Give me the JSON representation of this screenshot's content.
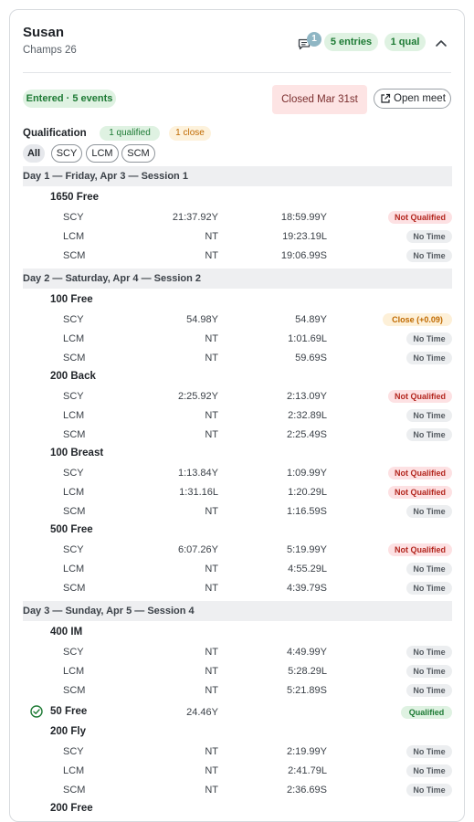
{
  "header": {
    "name": "Susan",
    "meet": "Champs 26",
    "message_count": "1",
    "entries_badge": "5 entries",
    "qual_badge": "1 qual"
  },
  "status": {
    "entered": "Entered · 5 events",
    "closed": "Closed Mar 31st",
    "open_meet": "Open meet"
  },
  "qualification": {
    "label": "Qualification",
    "qualified_badge": "1 qualified",
    "close_badge": "1 close"
  },
  "filters": [
    "All",
    "SCY",
    "LCM",
    "SCM"
  ],
  "colors": {
    "not_qualified": "#b3261e",
    "qualified": "#1d7a34",
    "close": "#c06a00",
    "day_header_bg": "#eeeff1"
  },
  "days": [
    {
      "title": "Day 1 — Friday, Apr 3 — Session 1",
      "events": [
        {
          "name": "1650 Free",
          "rows": [
            {
              "course": "SCY",
              "best": "21:37.92Y",
              "std": "18:59.99Y",
              "status": "Not Qualified",
              "kind": "nq"
            },
            {
              "course": "LCM",
              "best": "NT",
              "std": "19:23.19L",
              "status": "No Time",
              "kind": "nt"
            },
            {
              "course": "SCM",
              "best": "NT",
              "std": "19:06.99S",
              "status": "No Time",
              "kind": "nt"
            }
          ]
        }
      ]
    },
    {
      "title": "Day 2 — Saturday, Apr 4 — Session 2",
      "events": [
        {
          "name": "100 Free",
          "rows": [
            {
              "course": "SCY",
              "best": "54.98Y",
              "std": "54.89Y",
              "status": "Close (+0.09)",
              "kind": "cl"
            },
            {
              "course": "LCM",
              "best": "NT",
              "std": "1:01.69L",
              "status": "No Time",
              "kind": "nt"
            },
            {
              "course": "SCM",
              "best": "NT",
              "std": "59.69S",
              "status": "No Time",
              "kind": "nt"
            }
          ]
        },
        {
          "name": "200 Back",
          "rows": [
            {
              "course": "SCY",
              "best": "2:25.92Y",
              "std": "2:13.09Y",
              "status": "Not Qualified",
              "kind": "nq"
            },
            {
              "course": "LCM",
              "best": "NT",
              "std": "2:32.89L",
              "status": "No Time",
              "kind": "nt"
            },
            {
              "course": "SCM",
              "best": "NT",
              "std": "2:25.49S",
              "status": "No Time",
              "kind": "nt"
            }
          ]
        },
        {
          "name": "100 Breast",
          "rows": [
            {
              "course": "SCY",
              "best": "1:13.84Y",
              "std": "1:09.99Y",
              "status": "Not Qualified",
              "kind": "nq"
            },
            {
              "course": "LCM",
              "best": "1:31.16L",
              "std": "1:20.29L",
              "status": "Not Qualified",
              "kind": "nq"
            },
            {
              "course": "SCM",
              "best": "NT",
              "std": "1:16.59S",
              "status": "No Time",
              "kind": "nt"
            }
          ]
        },
        {
          "name": "500 Free",
          "rows": [
            {
              "course": "SCY",
              "best": "6:07.26Y",
              "std": "5:19.99Y",
              "status": "Not Qualified",
              "kind": "nq"
            },
            {
              "course": "LCM",
              "best": "NT",
              "std": "4:55.29L",
              "status": "No Time",
              "kind": "nt"
            },
            {
              "course": "SCM",
              "best": "NT",
              "std": "4:39.79S",
              "status": "No Time",
              "kind": "nt"
            }
          ]
        }
      ]
    },
    {
      "title": "Day 3 — Sunday, Apr 5 — Session 4",
      "events": [
        {
          "name": "400 IM",
          "rows": [
            {
              "course": "SCY",
              "best": "NT",
              "std": "4:49.99Y",
              "status": "No Time",
              "kind": "nt"
            },
            {
              "course": "LCM",
              "best": "NT",
              "std": "5:28.29L",
              "status": "No Time",
              "kind": "nt"
            },
            {
              "course": "SCM",
              "best": "NT",
              "std": "5:21.89S",
              "status": "No Time",
              "kind": "nt"
            }
          ]
        },
        {
          "name": "50 Free",
          "qualified_line": {
            "best": "24.46Y",
            "status": "Qualified"
          },
          "rows": []
        },
        {
          "name": "200 Fly",
          "rows": [
            {
              "course": "SCY",
              "best": "NT",
              "std": "2:19.99Y",
              "status": "No Time",
              "kind": "nt"
            },
            {
              "course": "LCM",
              "best": "NT",
              "std": "2:41.79L",
              "status": "No Time",
              "kind": "nt"
            },
            {
              "course": "SCM",
              "best": "NT",
              "std": "2:36.69S",
              "status": "No Time",
              "kind": "nt"
            }
          ]
        },
        {
          "name": "200 Free",
          "rows": []
        }
      ]
    }
  ]
}
